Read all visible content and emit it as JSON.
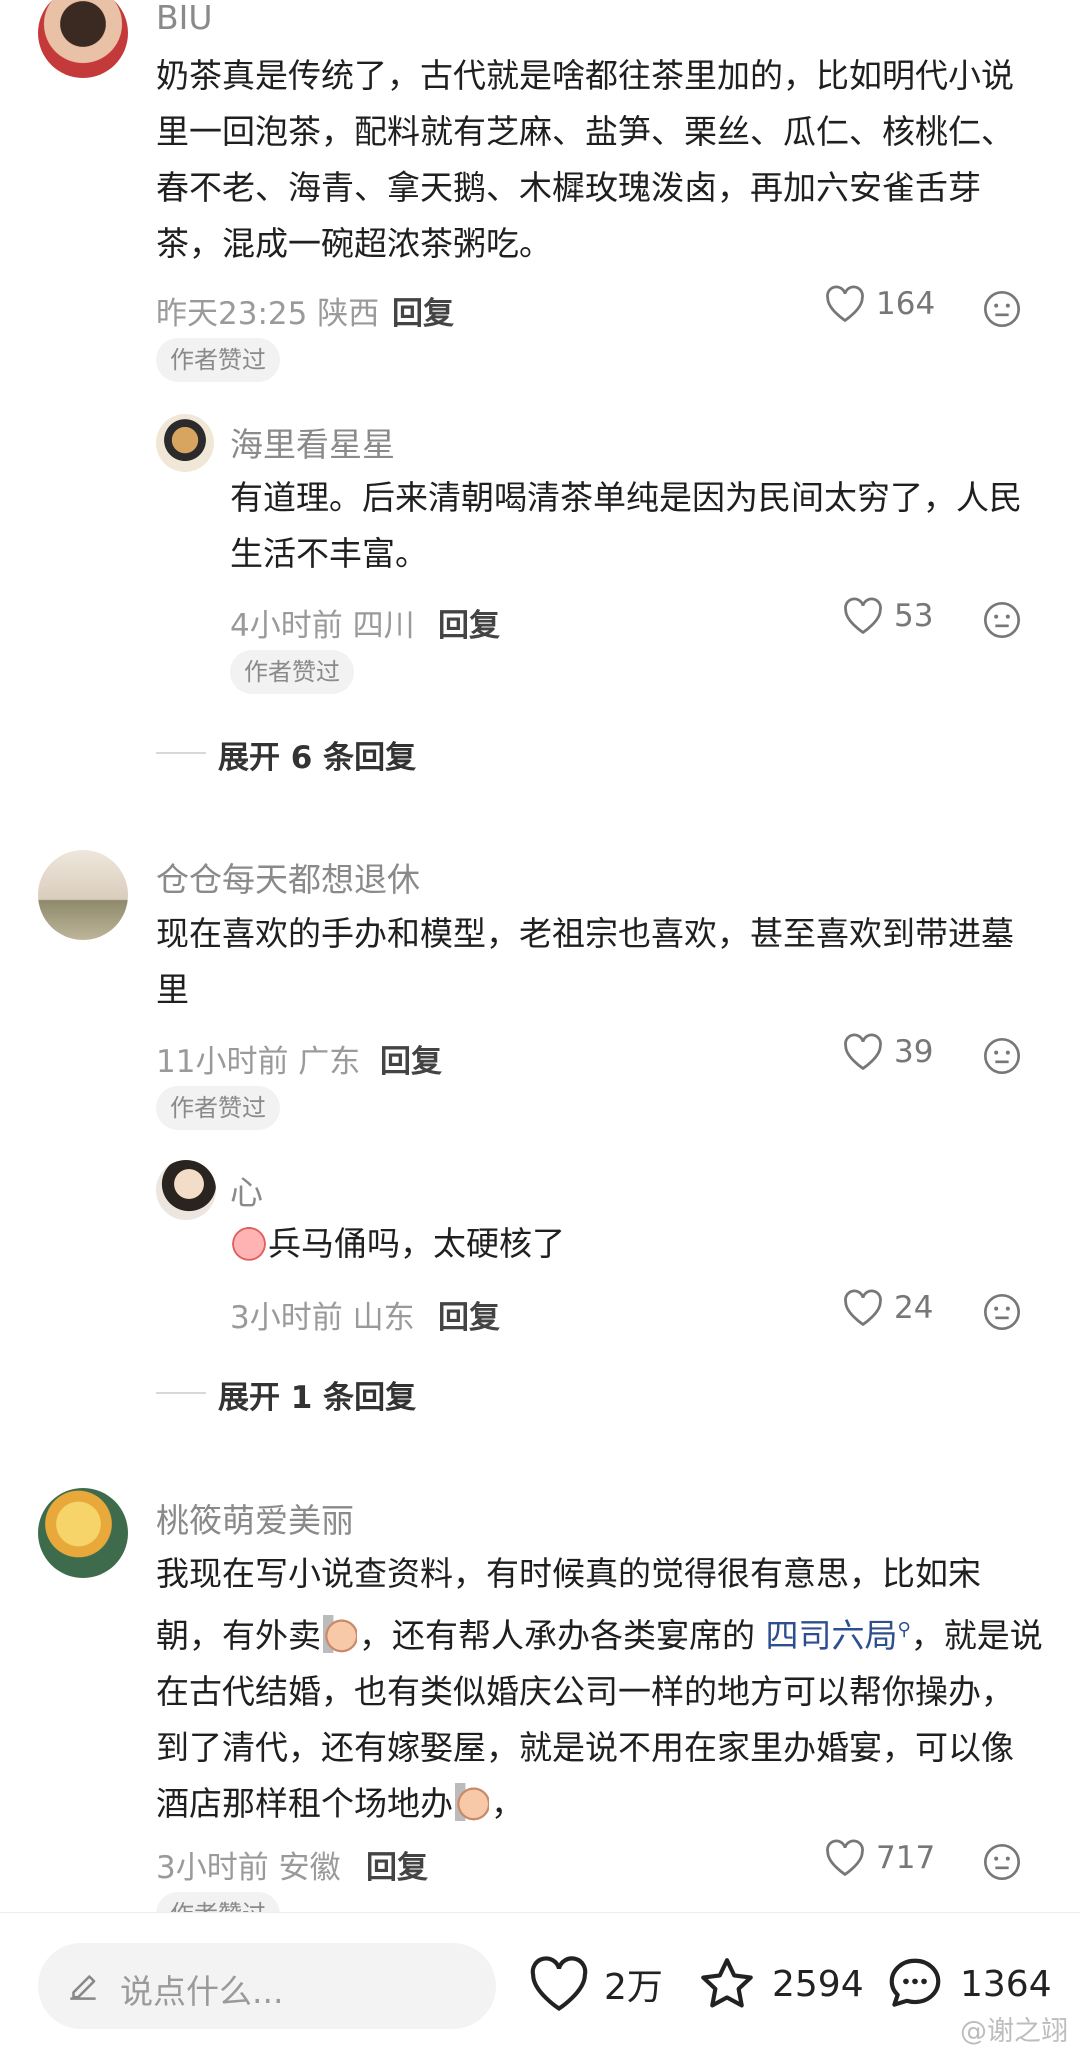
{
  "comments": [
    {
      "user": "BIU",
      "text": "奶茶真是传统了，古代就是啥都往茶里加的，比如明代小说里一回泡茶，配料就有芝麻、盐笋、栗丝、瓜仁、核桃仁、春不老、海青、拿天鹅、木樨玫瑰泼卤，再加六安雀舌芽茶，混成一碗超浓茶粥吃。",
      "time_location": "昨天23:25 陕西",
      "reply_label": "回复",
      "likes": "164",
      "badge": "作者赞过",
      "sub": {
        "user": "海里看星星",
        "text": "有道理。后来清朝喝清茶单纯是因为民间太穷了，人民生活不丰富。",
        "time_location": "4小时前 四川",
        "reply_label": "回复",
        "likes": "53",
        "badge": "作者赞过"
      },
      "expand_label": "展开 6 条回复"
    },
    {
      "user": "仓仓每天都想退休",
      "text": "现在喜欢的手办和模型，老祖宗也喜欢，甚至喜欢到带进墓里",
      "time_location": "11小时前 广东",
      "reply_label": "回复",
      "likes": "39",
      "badge": "作者赞过",
      "sub": {
        "user": "心",
        "text": "兵马俑吗，太硬核了",
        "time_location": "3小时前 山东",
        "reply_label": "回复",
        "likes": "24"
      },
      "expand_label": "展开 1 条回复"
    },
    {
      "user": "桃筱萌爱美丽",
      "text_parts": {
        "a": "我现在写小说查资料，有时候真的觉得很有意思，比如宋朝，有外卖",
        "b": "，还有帮人承办各类宴席的 ",
        "link": "四司六局",
        "c": "，就是说在古代结婚，也有类似婚庆公司一样的地方可以帮你操办，到了清代，还有嫁娶屋，就是说不用在家里办婚宴，可以像酒店那样租个场地办",
        "d": "，"
      },
      "time_location": "3小时前 安徽",
      "reply_label": "回复",
      "likes": "717",
      "badge": "作者赞过"
    }
  ],
  "bottom_bar": {
    "input_placeholder": "说点什么...",
    "likes": "2万",
    "favorites": "2594",
    "comments": "1364"
  },
  "watermark": "@谢之翊",
  "icons": {
    "like": "heart-outline-icon",
    "emoji": "neutral-face-icon",
    "pen": "pen-icon",
    "star": "star-outline-icon",
    "comment": "speech-bubble-icon"
  },
  "colors": {
    "text": "#1f1f1f",
    "meta": "#9a9a9a",
    "link": "#2d4f8e",
    "badge_bg": "#f2f2f2"
  }
}
